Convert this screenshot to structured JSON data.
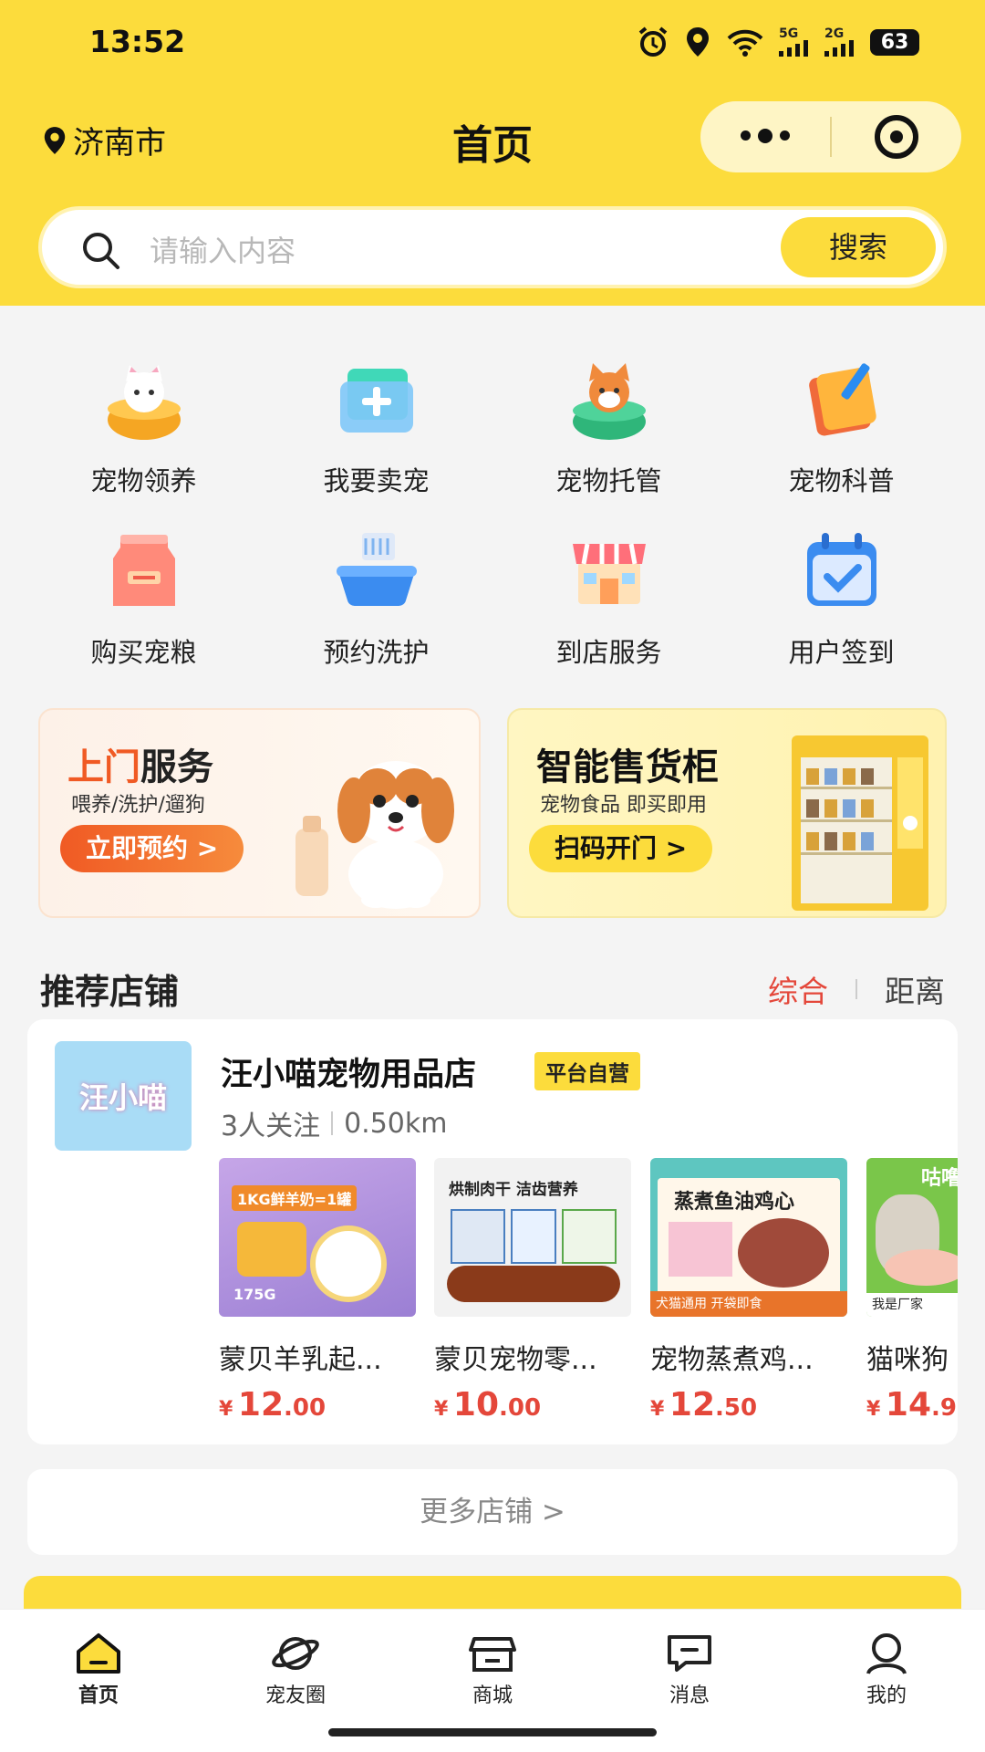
{
  "status": {
    "time": "13:52",
    "battery": "63",
    "net1": "5G",
    "net2": "2G"
  },
  "nav": {
    "city": "济南市",
    "title": "首页"
  },
  "search": {
    "placeholder": "请输入内容",
    "button": "搜索"
  },
  "grid": [
    {
      "label": "宠物领养",
      "icon": "cat-bowl-icon"
    },
    {
      "label": "我要卖宠",
      "icon": "folder-plus-icon"
    },
    {
      "label": "宠物托管",
      "icon": "dog-bed-icon"
    },
    {
      "label": "宠物科普",
      "icon": "book-pencil-icon"
    },
    {
      "label": "购买宠粮",
      "icon": "food-bag-icon"
    },
    {
      "label": "预约洗护",
      "icon": "bath-tub-icon"
    },
    {
      "label": "到店服务",
      "icon": "store-icon"
    },
    {
      "label": "用户签到",
      "icon": "calendar-check-icon"
    }
  ],
  "banners": {
    "home_service": {
      "title_a": "上门",
      "title_b": "服务",
      "subtitle": "喂养/洗护/遛狗",
      "button": "立即预约 >"
    },
    "vending": {
      "title": "智能售货柜",
      "subtitle": "宠物食品 即买即用",
      "button": "扫码开门 >"
    }
  },
  "section": {
    "title": "推荐店铺",
    "sort_active": "综合",
    "sort_other": "距离"
  },
  "shop": {
    "logo_text": "汪小喵",
    "name": "汪小喵宠物用品店",
    "badge": "平台自营",
    "followers": "3人关注",
    "distance": "0.50km",
    "products": [
      {
        "name": "蒙贝羊乳起...",
        "currency": "¥",
        "int": "12",
        "dec": ".00",
        "img_text": "1KG鲜羊奶=1罐",
        "img_sub": "175G"
      },
      {
        "name": "蒙贝宠物零...",
        "currency": "¥",
        "int": "10",
        "dec": ".00",
        "img_text": "烘制肉干 洁齿营养"
      },
      {
        "name": "宠物蒸煮鸡...",
        "currency": "¥",
        "int": "12",
        "dec": ".50",
        "img_text": "蒸煮鱼油鸡心",
        "img_sub": "犬猫通用 开袋即食"
      },
      {
        "name": "猫咪狗",
        "currency": "¥",
        "int": "14",
        "dec": ".9",
        "img_text": "咕噜",
        "img_sub": "我是厂家"
      }
    ]
  },
  "more_shops": "更多店铺  >",
  "tabs": [
    {
      "label": "首页",
      "icon": "home-icon"
    },
    {
      "label": "宠友圈",
      "icon": "planet-icon"
    },
    {
      "label": "商城",
      "icon": "shop-icon"
    },
    {
      "label": "消息",
      "icon": "message-icon"
    },
    {
      "label": "我的",
      "icon": "user-icon"
    }
  ],
  "colors": {
    "brand": "#fcdc3c",
    "price": "#e4473a",
    "orange": "#f05a24"
  }
}
